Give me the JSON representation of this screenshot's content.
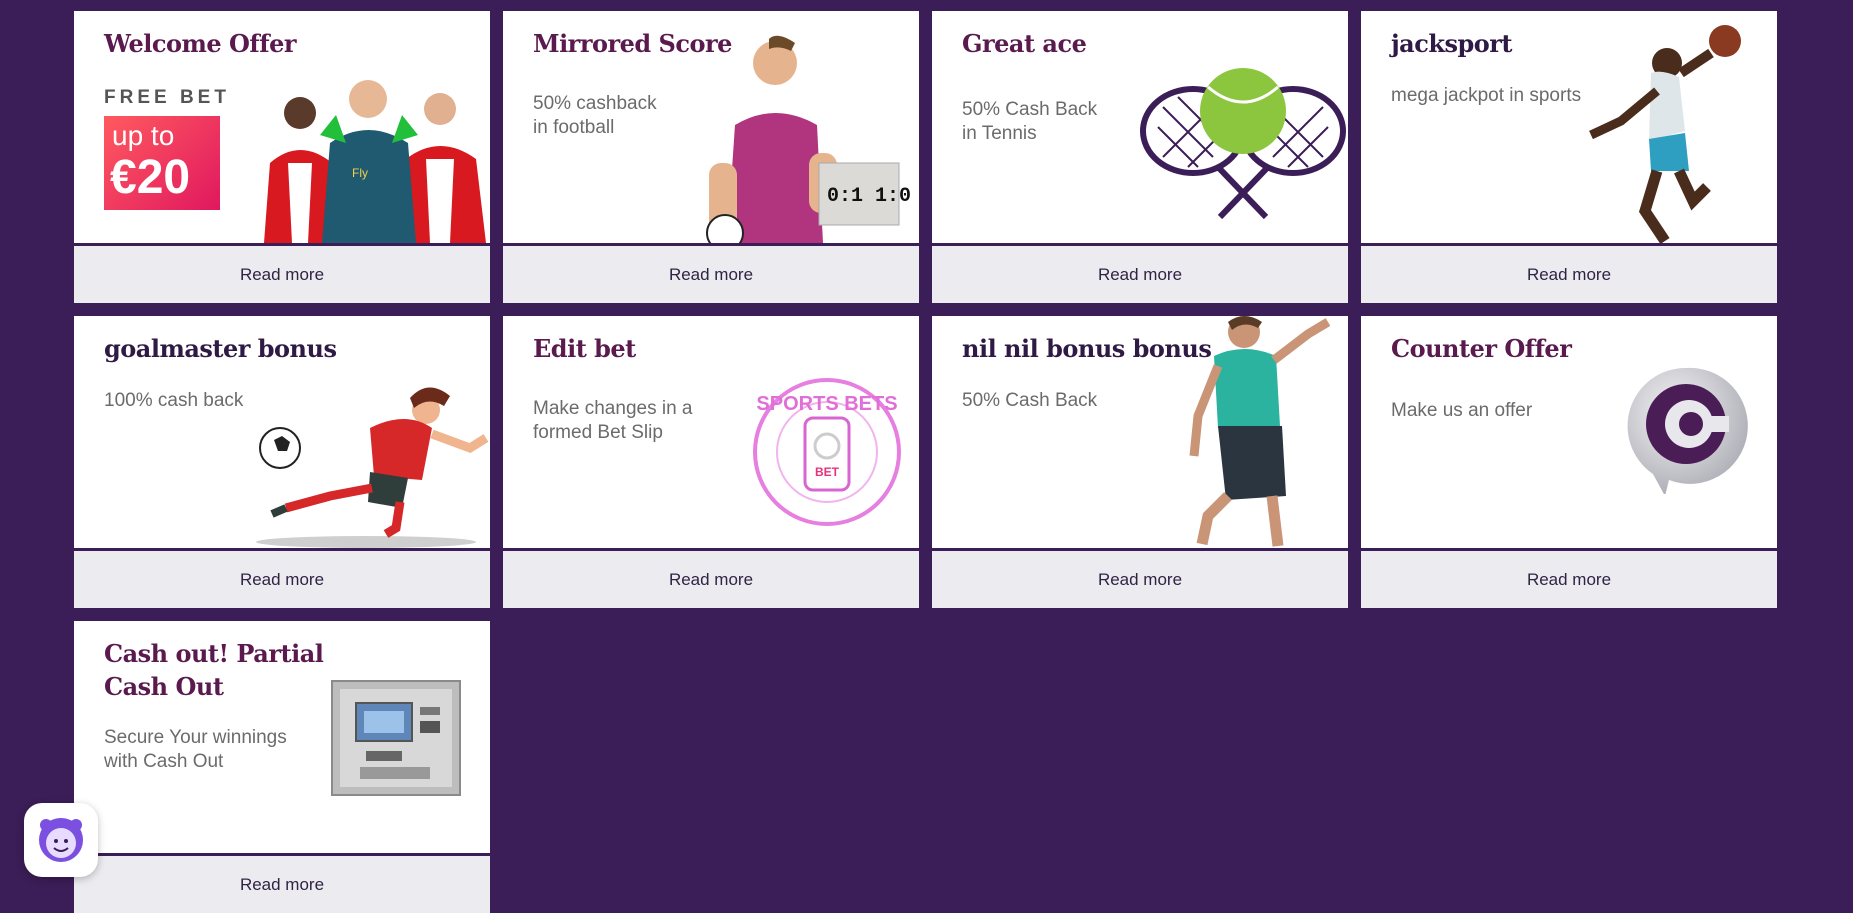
{
  "cards": [
    {
      "title": "Welcome Offer",
      "kicker": "FREE BET",
      "promo_line1": "up to",
      "promo_line2": "€20",
      "cta": "Read more"
    },
    {
      "title": "Mirrored Score",
      "subtitle_line1": "50% cashback",
      "subtitle_line2": "in football",
      "score": "0:1 1:0",
      "cta": "Read more"
    },
    {
      "title": "Great ace",
      "subtitle_line1": "50% Cash Back",
      "subtitle_line2": "in Tennis",
      "cta": "Read more"
    },
    {
      "title": "jacksport",
      "subtitle_line1": "mega jackpot in sports",
      "cta": "Read more"
    },
    {
      "title": "goalmaster bonus",
      "subtitle_line1": "100% cash back",
      "cta": "Read more"
    },
    {
      "title": "Edit bet",
      "subtitle_line1": "Make changes in a",
      "subtitle_line2": "formed Bet Slip",
      "neon_text": "SPORTS BETS",
      "neon_badge": "BET",
      "cta": "Read more"
    },
    {
      "title": "nil nil bonus bonus",
      "subtitle_line1": "50% Cash Back",
      "cta": "Read more"
    },
    {
      "title": "Counter Offer",
      "subtitle_line1": "Make us an offer",
      "cta": "Read more"
    },
    {
      "title_line1": "Cash out! Partial",
      "title_line2": "Cash Out",
      "subtitle_line1": "Secure Your winnings",
      "subtitle_line2": "with Cash Out",
      "cta": "Read more"
    }
  ],
  "colors": {
    "background": "#3b1d57",
    "title": "#5a1a4e",
    "footer": "#ececf0"
  },
  "chat_widget": {
    "icon": "chat-avatar-icon"
  }
}
